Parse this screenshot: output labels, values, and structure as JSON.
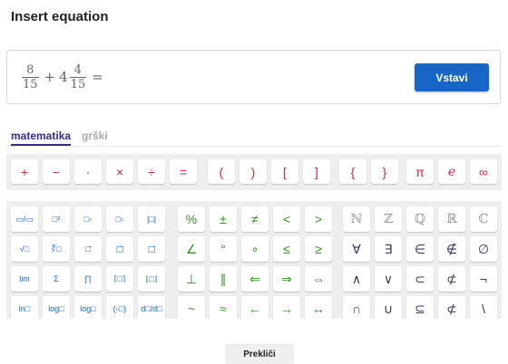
{
  "dialog": {
    "title": "Insert equation"
  },
  "editor": {
    "formula": {
      "f1_num": "8",
      "f1_den": "15",
      "plus": "+",
      "whole": "4",
      "f2_num": "4",
      "f2_den": "15",
      "equals": "="
    },
    "insert_label": "Vstavi"
  },
  "tabs": [
    {
      "label": "matematika",
      "active": true
    },
    {
      "label": "grški",
      "active": false
    }
  ],
  "operators": [
    "+",
    "−",
    "·",
    "×",
    "÷",
    "=",
    "(",
    ")",
    "[",
    "]",
    "{",
    "}",
    "π",
    "e",
    "∞"
  ],
  "symbol_rows": [
    [
      "▭/▭",
      "□²",
      "□▫",
      "□▫",
      "|□|",
      "%",
      "±",
      "≠",
      "<",
      ">",
      "ℕ",
      "ℤ",
      "ℚ",
      "ℝ",
      "ℂ"
    ],
    [
      "√□",
      "∜□",
      "□̄",
      "□⃖",
      "□⃗",
      "∠",
      "°",
      "∘",
      "≤",
      "≥",
      "∀",
      "∃",
      "∈",
      "∉",
      "∅"
    ],
    [
      "lim",
      "Σ",
      "∏",
      "⌈□⌉",
      "⌊□⌋",
      "⊥",
      "∥",
      "⇐",
      "⇒",
      "⇔",
      "∧",
      "∨",
      "⊂",
      "⊄",
      "¬"
    ],
    [
      "ln□",
      "log□",
      "log□",
      "(▫□)",
      "d□/d□",
      "~",
      "≈",
      "←",
      "→",
      "↔",
      "∩",
      "∪",
      "⊆",
      "⊄",
      "\\"
    ]
  ],
  "colors": {
    "accent": "#1766c6",
    "tab_active": "#3a2a80",
    "operator": "#c8283c",
    "relation": "#3c8c2c"
  },
  "cancel_label": "Prekliči"
}
